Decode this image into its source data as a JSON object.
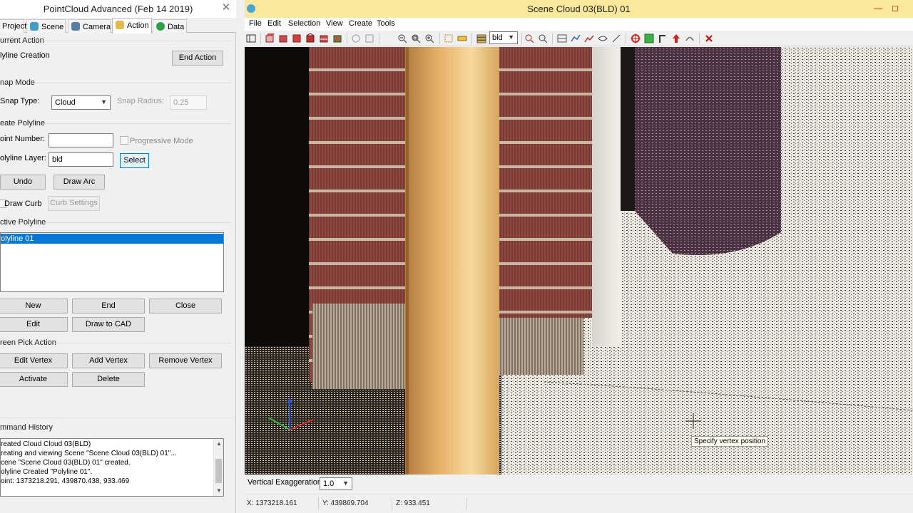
{
  "left_window": {
    "title": "PointCloud Advanced (Feb 14 2019)",
    "close": "✕",
    "tabs": [
      {
        "label": "Project",
        "icon": "folder-icon"
      },
      {
        "label": "Scene",
        "icon": "globe-icon"
      },
      {
        "label": "Camera",
        "icon": "camera-icon"
      },
      {
        "label": "Action",
        "icon": "hand-icon",
        "active": true
      },
      {
        "label": "Data",
        "icon": "data-icon"
      }
    ],
    "current_action": {
      "group": "urrent Action",
      "value": "lyline Creation",
      "end_button": "End Action"
    },
    "snap_mode": {
      "group": "nap Mode",
      "type_label": "Snap Type:",
      "type_value": "Cloud",
      "radius_label": "Snap Radius:",
      "radius_value": "0.25"
    },
    "create_polyline": {
      "group": "eate Polyline",
      "point_number_label": "oint Number:",
      "point_number_value": "",
      "progressive_label": "Progressive Mode",
      "layer_label": "olyline Layer:",
      "layer_value": "bld",
      "select_button": "Select",
      "undo_button": "Undo",
      "draw_arc_button": "Draw Arc",
      "draw_curb_label": "Draw Curb",
      "curb_settings_button": "Curb Settings"
    },
    "active_polyline": {
      "group": "ctive Polyline",
      "items": [
        "olyline 01"
      ],
      "new_button": "New",
      "end_button": "End",
      "close_button": "Close",
      "edit_button": "Edit",
      "draw_to_cad_button": "Draw to CAD"
    },
    "screen_pick": {
      "group": "reen Pick Action",
      "edit_vertex_button": "Edit Vertex",
      "add_vertex_button": "Add Vertex",
      "remove_vertex_button": "Remove Vertex",
      "activate_button": "Activate",
      "delete_button": "Delete"
    },
    "command_history": {
      "group": "mmand History",
      "lines": [
        "reated Cloud Cloud 03(BLD)",
        "reating and viewing Scene \"Scene Cloud 03(BLD) 01\"...",
        "cene \"Scene Cloud 03(BLD) 01\" created.",
        "olyline Created \"Polyline 01\".",
        "oint: 1373218.291, 439870.438, 933.469"
      ]
    }
  },
  "right_window": {
    "title": "Scene Cloud 03(BLD) 01",
    "minimize": "—",
    "maximize": "◻",
    "menu": [
      "File",
      "Edit",
      "Selection",
      "View",
      "Create",
      "Tools"
    ],
    "toolbar_layer_value": "bld",
    "tooltip": "Specify vertex position",
    "vertical_exaggeration_label": "Vertical Exaggeration",
    "vertical_exaggeration_value": "1.0",
    "status": {
      "x": "X: 1373218.161",
      "y": "Y: 439869.704",
      "z": "Z: 933.451"
    }
  },
  "colors": {
    "selection": "#0078d7",
    "title_active": "#fbe99b"
  }
}
